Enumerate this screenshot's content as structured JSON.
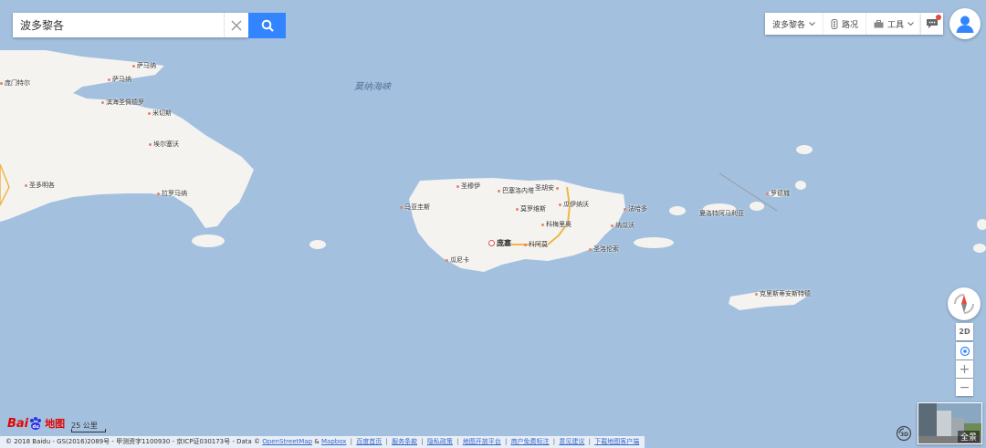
{
  "search": {
    "value": "波多黎各"
  },
  "toolbar": {
    "city": "波多黎各",
    "traffic": "路况",
    "tools": "工具"
  },
  "map": {
    "strait_label": "莫纳海峡",
    "places": [
      {
        "name": "萨马纳"
      },
      {
        "name": "萨马纳"
      },
      {
        "name": "庞门特尔"
      },
      {
        "name": "滨海圣佩德罗"
      },
      {
        "name": "米切斯"
      },
      {
        "name": "埃尔塞沃"
      },
      {
        "name": "圣多明各"
      },
      {
        "name": "拉罗马纳"
      },
      {
        "name": "圣胡安"
      },
      {
        "name": "圣穆伊"
      },
      {
        "name": "巴塞洛内塔"
      },
      {
        "name": "马亚圭斯"
      },
      {
        "name": "莫罗维斯"
      },
      {
        "name": "瓜伊纳沃"
      },
      {
        "name": "法哈多"
      },
      {
        "name": "科梅里奥"
      },
      {
        "name": "纳瓜沃"
      },
      {
        "name": "庞塞"
      },
      {
        "name": "科阿莫"
      },
      {
        "name": "圣洛伦索"
      },
      {
        "name": "瓜尼卡"
      },
      {
        "name": "夏洛特阿马利亚"
      },
      {
        "name": "罗德城"
      },
      {
        "name": "克里斯蒂安斯特德"
      }
    ]
  },
  "controls": {
    "two_d": "2D",
    "zoom_in": "+",
    "zoom_out": "−",
    "panorama": "全景"
  },
  "logo": {
    "bai": "Bai",
    "du": "du",
    "map": "地图"
  },
  "scale": "25 公里",
  "footer": {
    "copyright": "© 2018 Baidu - GS(2016)2089号 - 甲测资字1100930 - 京ICP证030173号 - Data ©",
    "osm": "OpenStreetMap",
    "amp": "&",
    "mapbox": "Mapbox",
    "links": [
      "百度首页",
      "服务条款",
      "隐私政策",
      "地图开放平台",
      "商户免费标注",
      "意见建议",
      "下载地图客户端"
    ]
  },
  "colors": {
    "sea": "#a3c0df",
    "land": "#f5f3f0",
    "accent": "#3385ff",
    "road": "#f0b546"
  }
}
